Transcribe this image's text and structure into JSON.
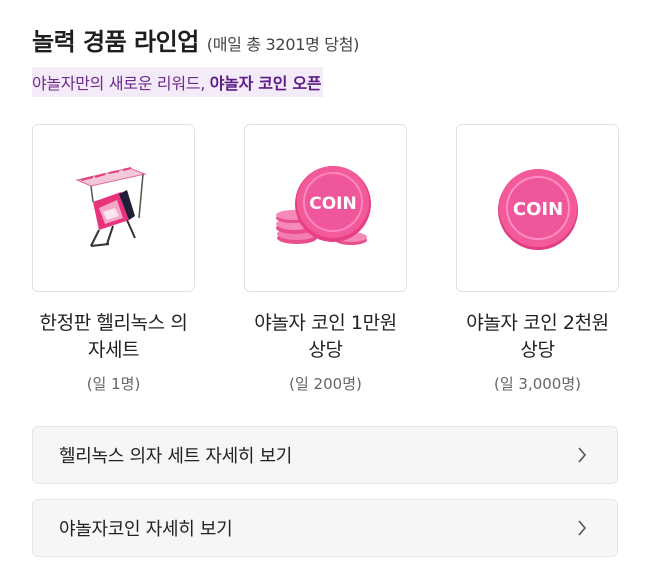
{
  "header": {
    "title": "놀력 경품 라인업",
    "title_note": "(매일 총 3201명 당첨)",
    "subtitle": "야놀자만의 새로운 리워드, ",
    "subtitle_strong": "야놀자 코인 오픈"
  },
  "prizes": [
    {
      "name": "한정판 헬리녹스 의자세트",
      "qty": "(일 1명)",
      "icon": "helinox-chair-icon"
    },
    {
      "name": "야놀자 코인 1만원 상당",
      "qty": "(일 200명)",
      "icon": "coin-stack-icon",
      "coin_text": "COIN"
    },
    {
      "name": "야놀자 코인 2천원 상당",
      "qty": "(일 3,000명)",
      "icon": "coin-icon",
      "coin_text": "COIN"
    }
  ],
  "links": [
    {
      "label": "헬리녹스 의자 세트 자세히 보기",
      "icon": "chevron-right-icon"
    },
    {
      "label": "야놀자코인 자세히 보기",
      "icon": "chevron-right-icon"
    }
  ],
  "colors": {
    "accent_purple": "#5b1a84",
    "highlight_bg": "#f4ebf8",
    "coin_pink": "#f0569b"
  }
}
